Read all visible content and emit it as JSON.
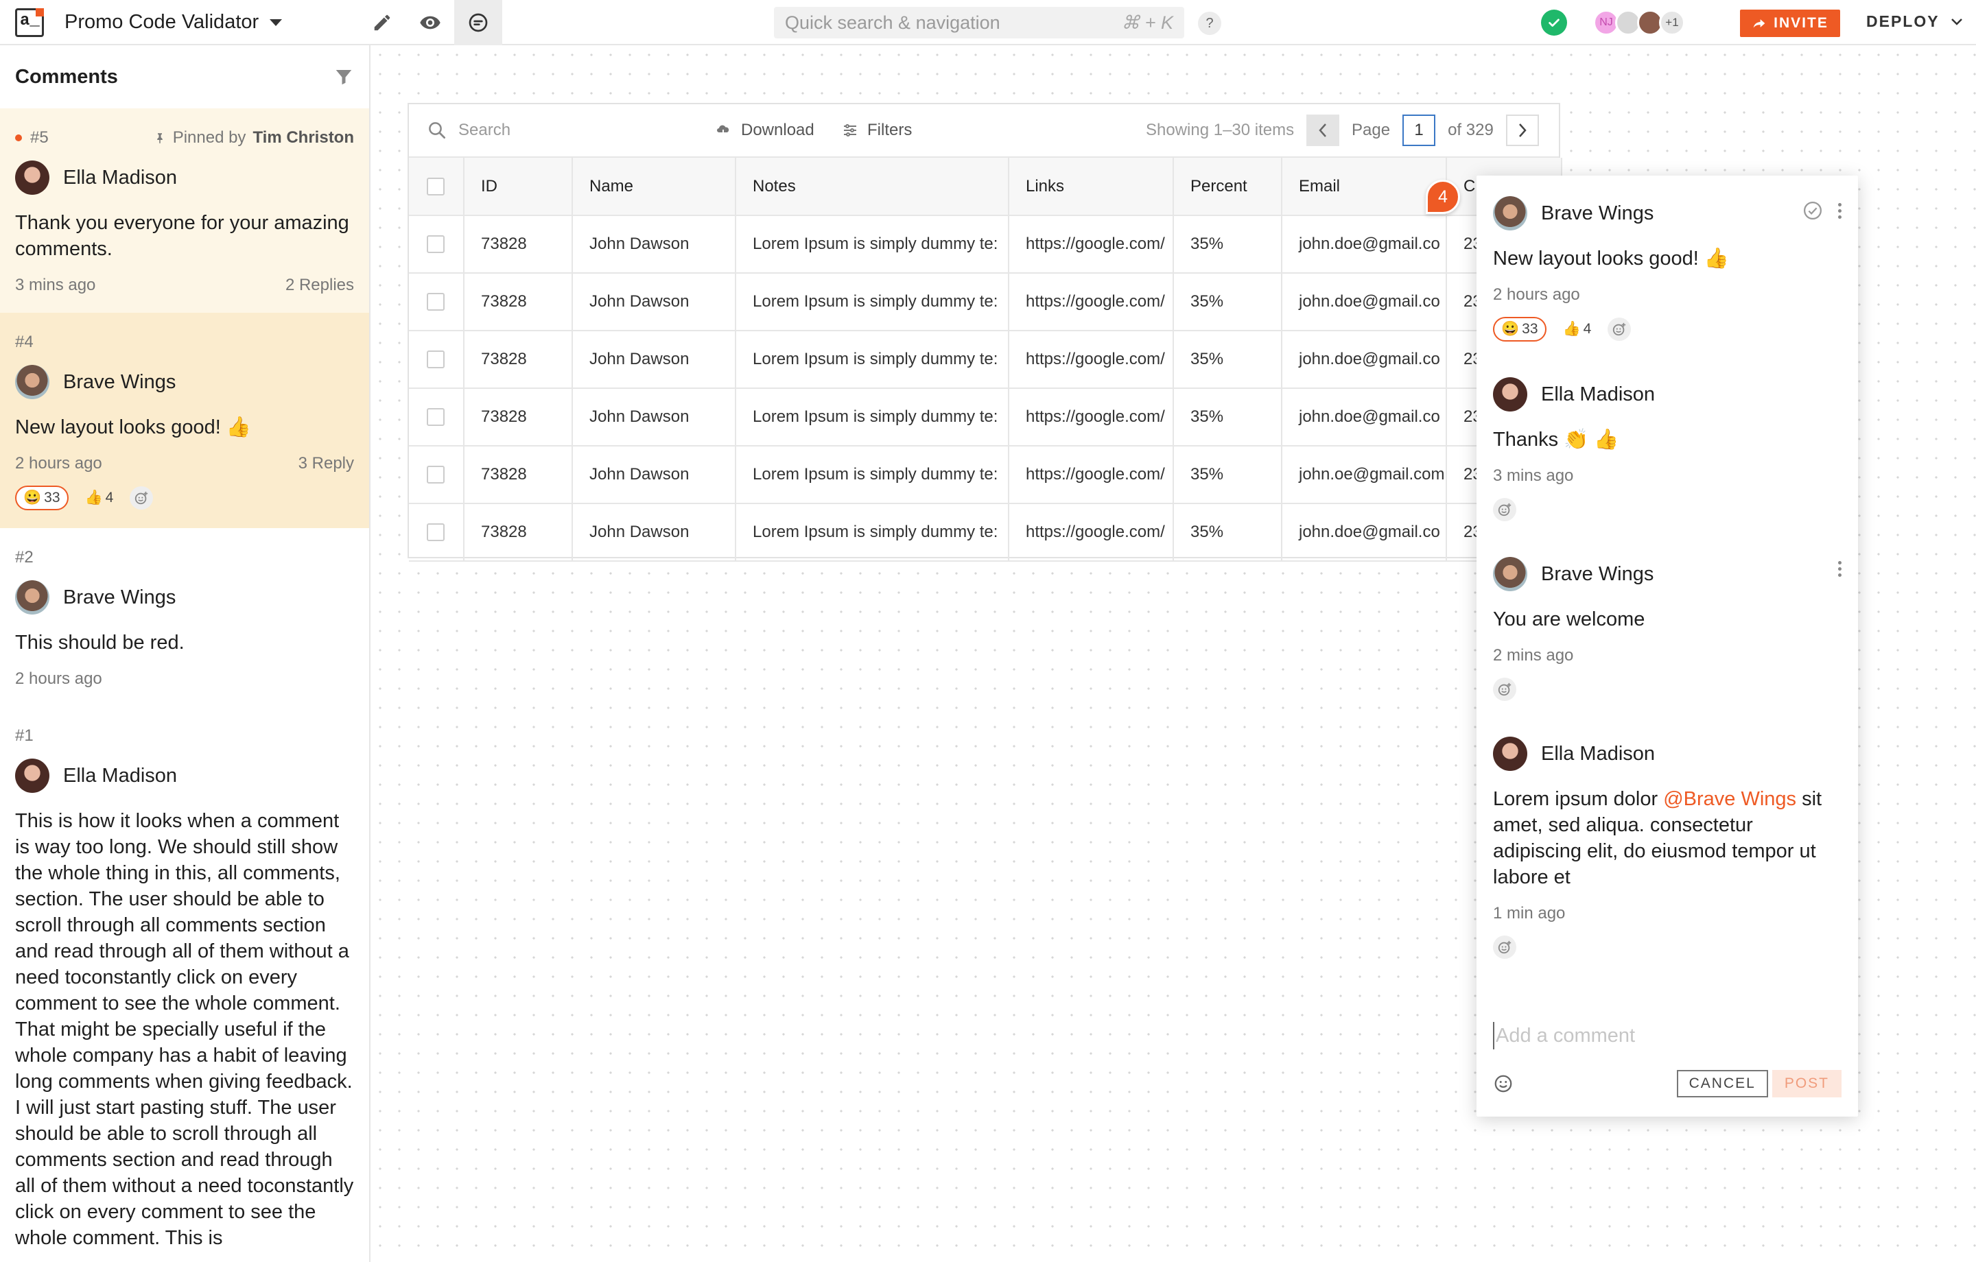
{
  "app": {
    "title": "Promo Code Validator",
    "logo_text": "a_",
    "search_placeholder": "Quick search & navigation",
    "search_shortcut": "⌘ + K",
    "help": "?",
    "invite_label": "INVITE",
    "deploy_label": "DEPLOY",
    "presence": [
      {
        "initials": "NJ"
      },
      {
        "initials": ""
      },
      {
        "initials": ""
      },
      {
        "initials": "+1"
      }
    ],
    "colors": {
      "accent": "#ee5a24",
      "ok": "#1fb86a",
      "link": "#3b78c5"
    }
  },
  "comments_panel": {
    "title": "Comments",
    "threads": [
      {
        "number": "#5",
        "unread": true,
        "pinned_label": "Pinned by",
        "pinned_by": "Tim Christon",
        "author": "Ella Madison",
        "text": "Thank you everyone for your amazing comments.",
        "time": "3 mins ago",
        "replies": "2 Replies"
      },
      {
        "number": "#4",
        "author": "Brave Wings",
        "text": "New layout looks good! 👍",
        "time": "2 hours ago",
        "replies": "3 Reply",
        "reactions": [
          {
            "emoji": "😀",
            "count": "33"
          },
          {
            "emoji": "👍",
            "count": "4"
          }
        ]
      },
      {
        "number": "#2",
        "author": "Brave Wings",
        "text": "This should be red.",
        "time": "2 hours ago"
      },
      {
        "number": "#1",
        "author": "Ella Madison",
        "text": "This is how it looks when a comment is way too long. We should still show the whole thing in this, all comments, section. The user should be able to scroll through all comments section and read through all of them without a need toconstantly click on every comment to see the whole comment. That might be specially useful if the whole company has a habit of leaving long comments when giving feedback. I will just start pasting stuff. The user should be able to scroll through all comments section and read through all of them without a need toconstantly click on every comment to see the whole comment. This is"
      }
    ]
  },
  "table": {
    "search_placeholder": "Search",
    "download_label": "Download",
    "filters_label": "Filters",
    "showing": "Showing 1–30 items",
    "page_label": "Page",
    "page": "1",
    "of_pages": "of 329",
    "columns": [
      "ID",
      "Name",
      "Notes",
      "Links",
      "Percent",
      "Email",
      "C"
    ],
    "rows": [
      [
        "73828",
        "John Dawson",
        "Lorem Ipsum is simply dummy te:",
        "https://google.com/",
        "35%",
        "john.doe@gmail.co",
        "23"
      ],
      [
        "73828",
        "John Dawson",
        "Lorem Ipsum is simply dummy te:",
        "https://google.com/",
        "35%",
        "john.doe@gmail.co",
        "23"
      ],
      [
        "73828",
        "John Dawson",
        "Lorem Ipsum is simply dummy te:",
        "https://google.com/",
        "35%",
        "john.doe@gmail.co",
        "23"
      ],
      [
        "73828",
        "John Dawson",
        "Lorem Ipsum is simply dummy te:",
        "https://google.com/",
        "35%",
        "john.doe@gmail.co",
        "23"
      ],
      [
        "73828",
        "John Dawson",
        "Lorem Ipsum is simply dummy te:",
        "https://google.com/",
        "35%",
        "john.oe@gmail.com",
        "23"
      ],
      [
        "73828",
        "John Dawson",
        "Lorem Ipsum is simply dummy te:",
        "https://google.com/",
        "35%",
        "john.doe@gmail.co",
        "23"
      ]
    ]
  },
  "thread_marker": "4",
  "popover": {
    "comments": [
      {
        "author": "Brave Wings",
        "text": "New layout looks good! 👍",
        "time": "2 hours ago",
        "reactions": [
          {
            "emoji": "😀",
            "count": "33"
          },
          {
            "emoji": "👍",
            "count": "4"
          }
        ]
      },
      {
        "author": "Ella Madison",
        "text": "Thanks 👏 👍",
        "time": "3 mins ago"
      },
      {
        "author": "Brave Wings",
        "text": "You are welcome",
        "time": "2 mins ago"
      },
      {
        "author": "Ella Madison",
        "text_before": "Lorem ipsum dolor ",
        "mention": "@Brave Wings",
        "text_after": " sit amet, sed  aliqua. consectetur adipiscing elit, do eiusmod tempor ut labore et",
        "time": "1 min ago"
      }
    ],
    "input_placeholder": "Add a comment",
    "cancel_label": "CANCEL",
    "post_label": "POST"
  }
}
